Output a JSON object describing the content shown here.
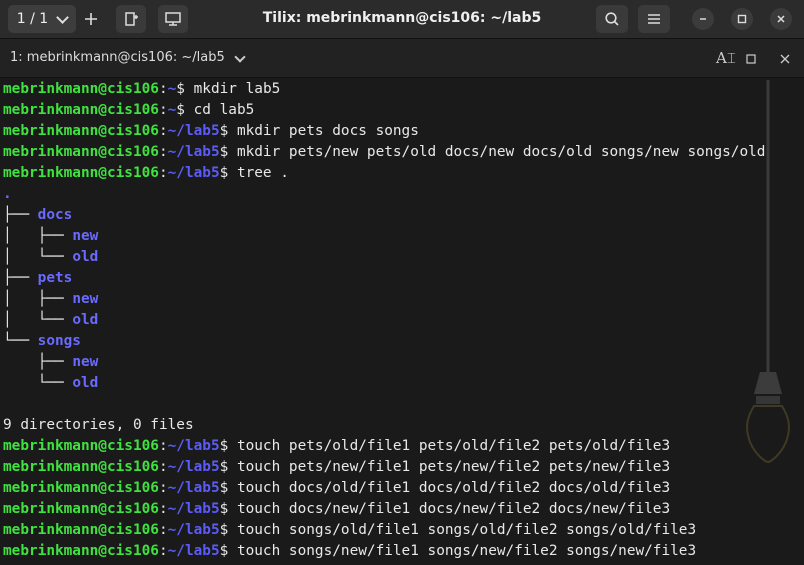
{
  "header": {
    "session_label": "1 / 1",
    "title": "Tilix: mebrinkmann@cis106: ~/lab5"
  },
  "terminal_tab": {
    "title": "1: mebrinkmann@cis106: ~/lab5"
  },
  "terminal": {
    "lines": [
      {
        "type": "cmd",
        "user": "mebrinkmann@cis106",
        "path": "~",
        "cmd": " mkdir lab5"
      },
      {
        "type": "cmd",
        "user": "mebrinkmann@cis106",
        "path": "~",
        "cmd": " cd lab5"
      },
      {
        "type": "cmd",
        "user": "mebrinkmann@cis106",
        "path": "~/lab5",
        "cmd": " mkdir pets docs songs"
      },
      {
        "type": "cmd",
        "user": "mebrinkmann@cis106",
        "path": "~/lab5",
        "cmd": " mkdir pets/new pets/old docs/new docs/old songs/new songs/old"
      },
      {
        "type": "cmd",
        "user": "mebrinkmann@cis106",
        "path": "~/lab5",
        "cmd": " tree ."
      },
      {
        "type": "tree",
        "prefix": "",
        "name": "."
      },
      {
        "type": "tree",
        "prefix": "├── ",
        "name": "docs"
      },
      {
        "type": "tree",
        "prefix": "│   ├── ",
        "name": "new"
      },
      {
        "type": "tree",
        "prefix": "│   └── ",
        "name": "old"
      },
      {
        "type": "tree",
        "prefix": "├── ",
        "name": "pets"
      },
      {
        "type": "tree",
        "prefix": "│   ├── ",
        "name": "new"
      },
      {
        "type": "tree",
        "prefix": "│   └── ",
        "name": "old"
      },
      {
        "type": "tree",
        "prefix": "└── ",
        "name": "songs"
      },
      {
        "type": "tree",
        "prefix": "    ├── ",
        "name": "new"
      },
      {
        "type": "tree",
        "prefix": "    └── ",
        "name": "old"
      },
      {
        "type": "text",
        "text": ""
      },
      {
        "type": "text",
        "text": "9 directories, 0 files"
      },
      {
        "type": "cmd",
        "user": "mebrinkmann@cis106",
        "path": "~/lab5",
        "cmd": " touch pets/old/file1 pets/old/file2 pets/old/file3"
      },
      {
        "type": "cmd",
        "user": "mebrinkmann@cis106",
        "path": "~/lab5",
        "cmd": " touch pets/new/file1 pets/new/file2 pets/new/file3"
      },
      {
        "type": "cmd",
        "user": "mebrinkmann@cis106",
        "path": "~/lab5",
        "cmd": " touch docs/old/file1 docs/old/file2 docs/old/file3"
      },
      {
        "type": "cmd",
        "user": "mebrinkmann@cis106",
        "path": "~/lab5",
        "cmd": " touch docs/new/file1 docs/new/file2 docs/new/file3"
      },
      {
        "type": "cmd",
        "user": "mebrinkmann@cis106",
        "path": "~/lab5",
        "cmd": " touch songs/old/file1 songs/old/file2 songs/old/file3"
      },
      {
        "type": "cmd",
        "user": "mebrinkmann@cis106",
        "path": "~/lab5",
        "cmd": " touch songs/new/file1 songs/new/file2 songs/new/file3"
      }
    ]
  },
  "colors": {
    "user": "#3fe23f",
    "path": "#5b5bf8",
    "directory": "#6a6aff",
    "text": "#e8e8e8",
    "background": "#1a1a1a"
  },
  "icons": {
    "session_dropdown": "chevron-down-icon",
    "add_terminal": "plus-icon",
    "new_session": "add-file-icon",
    "sync_input": "screen-icon",
    "search": "search-icon",
    "menu": "hamburger-icon",
    "minimize": "minimize-icon",
    "maximize": "maximize-icon",
    "close": "close-icon",
    "read_only": "text-cursor-icon",
    "maximize_terminal": "square-icon",
    "close_terminal": "close-icon",
    "background": "light-bulb-icon"
  }
}
